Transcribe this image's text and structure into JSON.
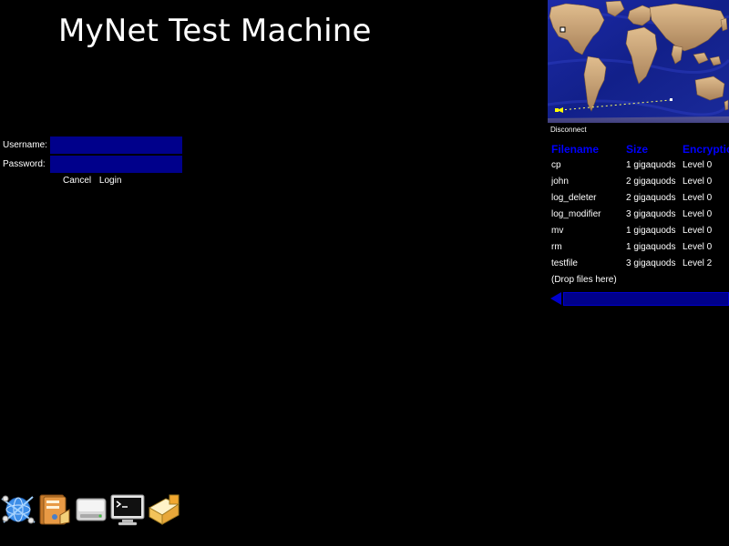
{
  "title": "MyNet Test Machine",
  "login": {
    "username_label": "Username:",
    "password_label": "Password:",
    "username_value": "",
    "password_value": "",
    "cancel_label": "Cancel",
    "login_label": "Login"
  },
  "map": {
    "disconnect_label": "Disconnect"
  },
  "files": {
    "columns": [
      "Filename",
      "Size",
      "Encryption"
    ],
    "rows": [
      {
        "name": "cp",
        "size": "1 gigaquods",
        "encryption": "Level 0"
      },
      {
        "name": "john",
        "size": "2 gigaquods",
        "encryption": "Level 0"
      },
      {
        "name": "log_deleter",
        "size": "2 gigaquods",
        "encryption": "Level 0"
      },
      {
        "name": "log_modifier",
        "size": "3 gigaquods",
        "encryption": "Level 0"
      },
      {
        "name": "mv",
        "size": "1 gigaquods",
        "encryption": "Level 0"
      },
      {
        "name": "rm",
        "size": "1 gigaquods",
        "encryption": "Level 0"
      },
      {
        "name": "testfile",
        "size": "3 gigaquods",
        "encryption": "Level 2"
      }
    ],
    "drop_label": "(Drop files here)"
  },
  "dock": {
    "icons": [
      "network-globe-icon",
      "file-manager-icon",
      "hard-drive-icon",
      "terminal-icon",
      "mail-icon"
    ]
  },
  "colors": {
    "background": "#000000",
    "input_bg": "#00008b",
    "header_text": "#0000ff",
    "ocean": "#1a2a9a",
    "land": "#c8a070"
  }
}
